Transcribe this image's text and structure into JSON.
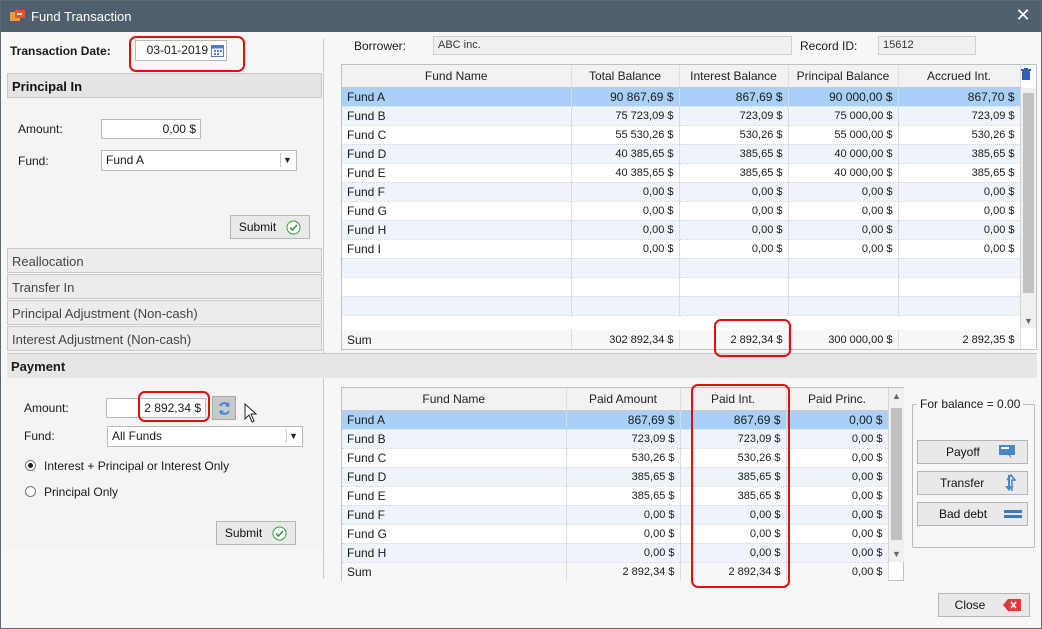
{
  "window": {
    "title": "Fund Transaction",
    "close_glyph": "✕"
  },
  "transaction_date": {
    "label": "Transaction Date:",
    "value": "03-01-2019"
  },
  "header": {
    "borrower_label": "Borrower:",
    "borrower_value": "ABC inc.",
    "record_label": "Record ID:",
    "record_value": "15612"
  },
  "principal_in": {
    "title": "Principal In",
    "amount_label": "Amount:",
    "amount_value": "0,00 $",
    "fund_label": "Fund:",
    "fund_value": "Fund A",
    "submit_label": "Submit"
  },
  "sections": [
    "Reallocation",
    "Transfer In",
    "Principal Adjustment (Non-cash)",
    "Interest Adjustment (Non-cash)"
  ],
  "payment": {
    "title": "Payment",
    "amount_label": "Amount:",
    "amount_value": "2 892,34 $",
    "fund_label": "Fund:",
    "fund_value": "All Funds",
    "option1": "Interest + Principal or Interest Only",
    "option2": "Principal Only",
    "selected_option": 1,
    "submit_label": "Submit"
  },
  "balances": {
    "columns": [
      "Fund Name",
      "Total Balance",
      "Interest Balance",
      "Principal Balance",
      "Accrued Int."
    ],
    "rows": [
      [
        "Fund A",
        "90 867,69 $",
        "867,69 $",
        "90 000,00 $",
        "867,70 $"
      ],
      [
        "Fund B",
        "75 723,09 $",
        "723,09 $",
        "75 000,00 $",
        "723,09 $"
      ],
      [
        "Fund C",
        "55 530,26 $",
        "530,26 $",
        "55 000,00 $",
        "530,26 $"
      ],
      [
        "Fund D",
        "40 385,65 $",
        "385,65 $",
        "40 000,00 $",
        "385,65 $"
      ],
      [
        "Fund E",
        "40 385,65 $",
        "385,65 $",
        "40 000,00 $",
        "385,65 $"
      ],
      [
        "Fund F",
        "0,00 $",
        "0,00 $",
        "0,00 $",
        "0,00 $"
      ],
      [
        "Fund G",
        "0,00 $",
        "0,00 $",
        "0,00 $",
        "0,00 $"
      ],
      [
        "Fund H",
        "0,00 $",
        "0,00 $",
        "0,00 $",
        "0,00 $"
      ],
      [
        "Fund I",
        "0,00 $",
        "0,00 $",
        "0,00 $",
        "0,00 $"
      ]
    ],
    "sum": [
      "Sum",
      "302 892,34 $",
      "2 892,34 $",
      "300 000,00 $",
      "2 892,35 $"
    ]
  },
  "payments": {
    "columns": [
      "Fund Name",
      "Paid Amount",
      "Paid Int.",
      "Paid Princ."
    ],
    "rows": [
      [
        "Fund A",
        "867,69 $",
        "867,69 $",
        "0,00 $"
      ],
      [
        "Fund B",
        "723,09 $",
        "723,09 $",
        "0,00 $"
      ],
      [
        "Fund C",
        "530,26 $",
        "530,26 $",
        "0,00 $"
      ],
      [
        "Fund D",
        "385,65 $",
        "385,65 $",
        "0,00 $"
      ],
      [
        "Fund E",
        "385,65 $",
        "385,65 $",
        "0,00 $"
      ],
      [
        "Fund F",
        "0,00 $",
        "0,00 $",
        "0,00 $"
      ],
      [
        "Fund G",
        "0,00 $",
        "0,00 $",
        "0,00 $"
      ],
      [
        "Fund H",
        "0,00 $",
        "0,00 $",
        "0,00 $"
      ]
    ],
    "sum": [
      "Sum",
      "2 892,34 $",
      "2 892,34 $",
      "0,00 $"
    ]
  },
  "balance_group": {
    "legend": "For balance = 0.00",
    "payoff_label": "Payoff",
    "transfer_label": "Transfer",
    "bad_debt_label": "Bad debt"
  },
  "close_label": "Close",
  "colors": {
    "title_bar": "#4f5f6d",
    "selected_row": "#a9d1f7",
    "highlight": "#e01010"
  }
}
